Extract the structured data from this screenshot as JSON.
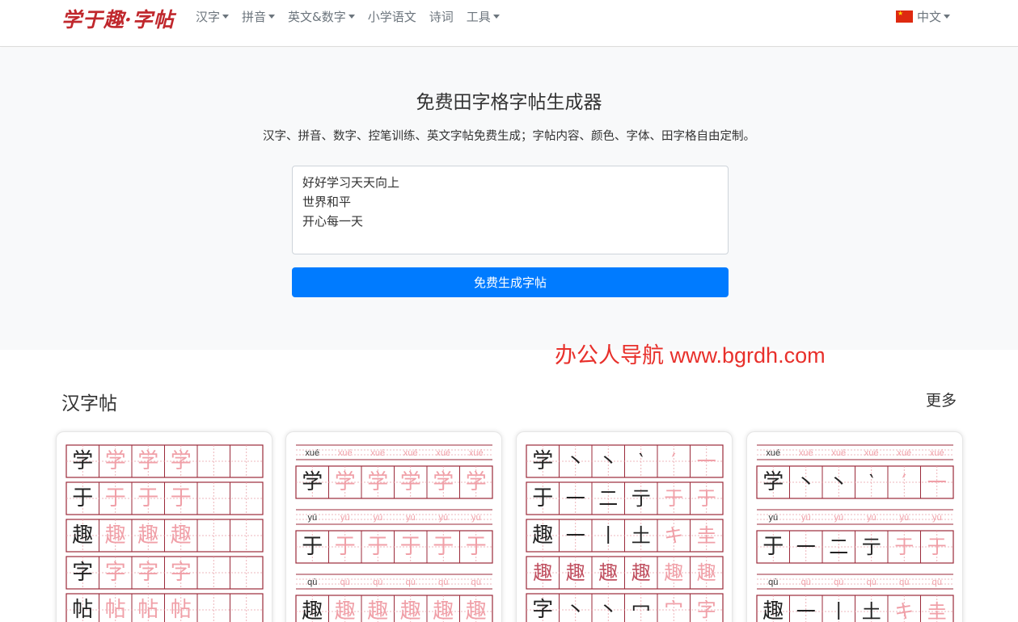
{
  "navbar": {
    "brand": "学于趣·字帖",
    "items": [
      {
        "label": "汉字",
        "dropdown": true
      },
      {
        "label": "拼音",
        "dropdown": true
      },
      {
        "label": "英文&数字",
        "dropdown": true
      },
      {
        "label": "小学语文",
        "dropdown": false
      },
      {
        "label": "诗词",
        "dropdown": false
      },
      {
        "label": "工具",
        "dropdown": true
      }
    ],
    "language": "中文"
  },
  "hero": {
    "title": "免费田字格字帖生成器",
    "subtitle": "汉字、拼音、数字、控笔训练、英文字帖免费生成；字帖内容、颜色、字体、田字格自由定制。",
    "textarea_value": "好好学习天天向上\n世界和平\n开心每一天",
    "button_label": "免费生成字帖"
  },
  "watermark": "办公人导航 www.bgrdh.com",
  "section": {
    "title": "汉字帖",
    "more": "更多"
  },
  "cards": [
    {
      "type": "trace",
      "chars": [
        "学",
        "于",
        "趣",
        "字",
        "帖"
      ]
    },
    {
      "type": "pinyin-trace",
      "rows": [
        {
          "pinyin": "xué",
          "char": "学"
        },
        {
          "pinyin": "yú",
          "char": "于"
        },
        {
          "pinyin": "qù",
          "char": "趣"
        }
      ]
    },
    {
      "type": "strokes",
      "rows": [
        {
          "char": "学",
          "strokes": [
            "丶",
            "丶",
            "‵",
            "′",
            "一"
          ]
        },
        {
          "char": "于",
          "strokes": [
            "一",
            "二",
            "亍",
            "于",
            "于"
          ]
        },
        {
          "char": "趣",
          "strokes": [
            "一",
            "丨",
            "土",
            "キ",
            "圭"
          ]
        },
        {
          "char": "趣",
          "strokes": [
            "趣",
            "趣",
            "趣",
            "趣",
            "趣",
            "趣"
          ]
        },
        {
          "char": "字",
          "strokes": [
            "丶",
            "丶",
            "冖",
            "宀",
            "字"
          ]
        }
      ]
    },
    {
      "type": "pinyin-strokes",
      "rows": [
        {
          "pinyin": "xué",
          "char": "学",
          "strokes": [
            "丶",
            "丶",
            "‵",
            "′",
            "一"
          ]
        },
        {
          "pinyin": "yú",
          "char": "于",
          "strokes": [
            "一",
            "二",
            "亍",
            "于",
            "于"
          ]
        },
        {
          "pinyin": "qù",
          "char": "趣",
          "strokes": [
            "一",
            "丨",
            "土",
            "キ",
            "圭"
          ]
        }
      ]
    }
  ],
  "colors": {
    "brand": "#c0282d",
    "primary": "#007bff",
    "grid": "#9b2a3a",
    "trace": "#f0a0a8",
    "watermark": "#e8302b"
  }
}
